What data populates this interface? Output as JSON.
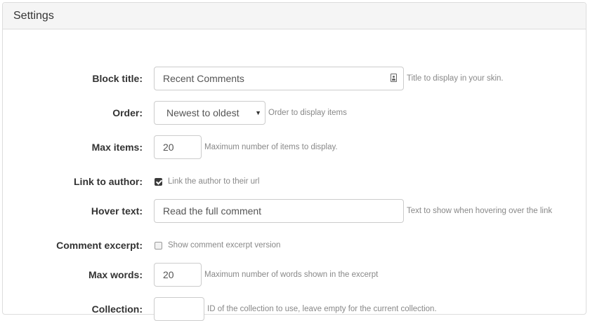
{
  "panel": {
    "title": "Settings"
  },
  "fields": {
    "block_title": {
      "label": "Block title:",
      "value": "Recent Comments",
      "help": "Title to display in your skin."
    },
    "order": {
      "label": "Order:",
      "value": "Newest to oldest",
      "help": "Order to display items"
    },
    "max_items": {
      "label": "Max items:",
      "value": "20",
      "help": "Maximum number of items to display."
    },
    "link_to_author": {
      "label": "Link to author:",
      "checked": true,
      "help": "Link the author to their url"
    },
    "hover_text": {
      "label": "Hover text:",
      "value": "Read the full comment",
      "help": "Text to show when hovering over the link"
    },
    "comment_excerpt": {
      "label": "Comment excerpt:",
      "checked": false,
      "help": "Show comment excerpt version"
    },
    "max_words": {
      "label": "Max words:",
      "value": "20",
      "help": "Maximum number of words shown in the excerpt"
    },
    "collection": {
      "label": "Collection:",
      "value": "",
      "help": "ID of the collection to use, leave empty for the current collection."
    }
  },
  "icons": {
    "block_title_field_icon": "contact-card-icon",
    "order_select_icon": "caret-down-icon"
  }
}
